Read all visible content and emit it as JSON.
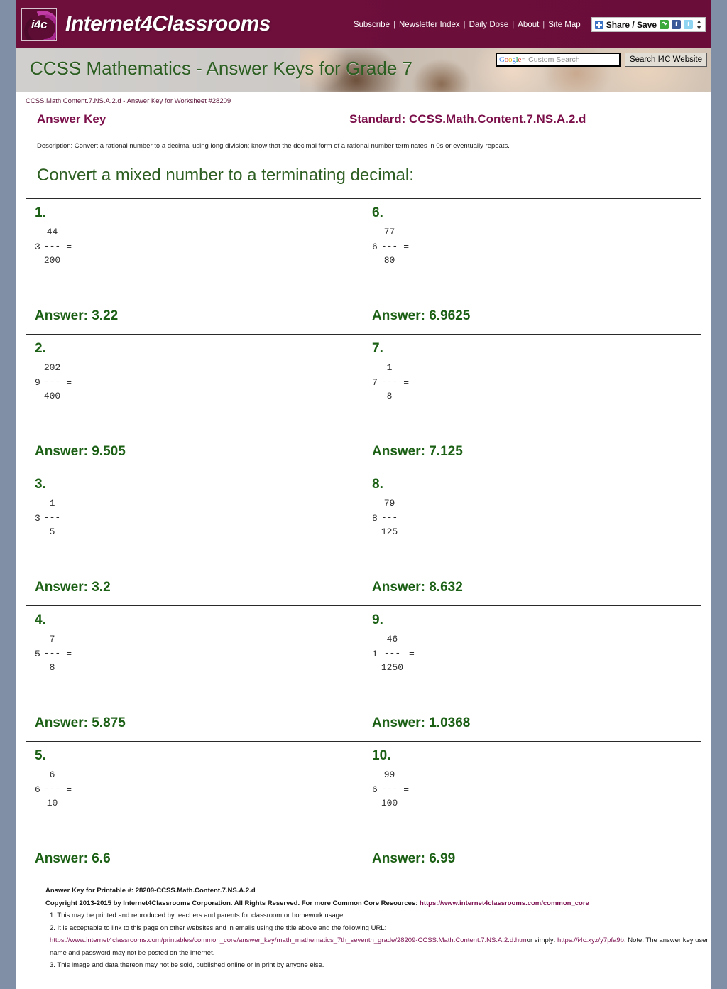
{
  "site": {
    "logo_text": "Internet4Classrooms",
    "logo_mark": "i4c",
    "nav": [
      {
        "label": "Subscribe"
      },
      {
        "label": "Newsletter Index"
      },
      {
        "label": "Daily Dose"
      },
      {
        "label": "About"
      },
      {
        "label": "Site Map"
      }
    ],
    "share": {
      "label": "Share / Save",
      "icons": [
        "plus-icon",
        "share-icon",
        "facebook-icon",
        "twitter-icon",
        "updown-caret-icon"
      ]
    }
  },
  "banner": {
    "title": "CCSS Mathematics - Answer Keys for Grade 7"
  },
  "search": {
    "brand": "Google",
    "tm": "™",
    "placeholder": "Custom Search",
    "value": "",
    "button_label": "Search I4C Website"
  },
  "document": {
    "breadcrumb": "CCSS.Math.Content.7.NS.A.2.d - Answer Key for Worksheet #28209",
    "answer_key_title": "Answer Key",
    "standard": "Standard: CCSS.Math.Content.7.NS.A.2.d",
    "description": "Description: Convert a rational number to a decimal using long division; know that the decimal form of a rational number terminates in 0s or eventually repeats.",
    "section_title": "Convert a mixed number to a terminating decimal:"
  },
  "problems": [
    {
      "num": "1.",
      "whole": "3",
      "numerator": "44",
      "bar": "---",
      "denominator": "200",
      "eq": "=",
      "answer": "Answer: 3.22"
    },
    {
      "num": "6.",
      "whole": "6",
      "numerator": "77",
      "bar": "---",
      "denominator": "80",
      "eq": "=",
      "answer": "Answer: 6.9625"
    },
    {
      "num": "2.",
      "whole": "9",
      "numerator": "202",
      "bar": "---",
      "denominator": "400",
      "eq": "=",
      "answer": "Answer: 9.505"
    },
    {
      "num": "7.",
      "whole": "7",
      "numerator": "1",
      "bar": "---",
      "denominator": "8",
      "eq": "=",
      "answer": "Answer: 7.125"
    },
    {
      "num": "3.",
      "whole": "3",
      "numerator": "1",
      "bar": "---",
      "denominator": "5",
      "eq": "=",
      "answer": "Answer: 3.2"
    },
    {
      "num": "8.",
      "whole": "8",
      "numerator": "79",
      "bar": "---",
      "denominator": "125",
      "eq": "=",
      "answer": "Answer: 8.632"
    },
    {
      "num": "4.",
      "whole": "5",
      "numerator": "7",
      "bar": "---",
      "denominator": "8",
      "eq": "=",
      "answer": "Answer: 5.875"
    },
    {
      "num": "9.",
      "whole": "1",
      "numerator": "46",
      "bar": "---",
      "denominator": "1250",
      "eq": "=",
      "answer": "Answer: 1.0368"
    },
    {
      "num": "5.",
      "whole": "6",
      "numerator": "6",
      "bar": "---",
      "denominator": "10",
      "eq": "=",
      "answer": "Answer: 6.6"
    },
    {
      "num": "10.",
      "whole": "6",
      "numerator": "99",
      "bar": "---",
      "denominator": "100",
      "eq": "=",
      "answer": "Answer: 6.99"
    }
  ],
  "footer": {
    "line1": "Answer Key for Printable #: 28209-CCSS.Math.Content.7.NS.A.2.d",
    "copyright_prefix": "Copyright 2013-2015 by Internet4Classrooms Corporation. All Rights Reserved. For more Common Core Resources:",
    "copyright_link": "https://www.internet4classrooms.com/common_core",
    "note1": "1. This may be printed and reproduced by teachers and parents for classroom or homework usage.",
    "note2": "2. It is acceptable to link to this page on other websites and in emails using the title above and the following URL:",
    "long_url": "https://www.internet4classrooms.com/printables/common_core/answer_key/math_mathematics_7th_seventh_grade/28209-CCSS.Math.Content.7.NS.A.2.d.htm",
    "url_joiner": "or simply:",
    "short_url": "https://i4c.xyz/y7pfa9b",
    "url_tail": ". Note: The answer key username and password may not be posted on the internet.",
    "note3": "3. This image and data thereon may not be sold, published online or in print by anyone else."
  },
  "colors": {
    "brand_purple": "#6e0f3c",
    "heading_green": "#2d5e22",
    "answer_green": "#1c6015",
    "page_bg": "#808ea6"
  }
}
